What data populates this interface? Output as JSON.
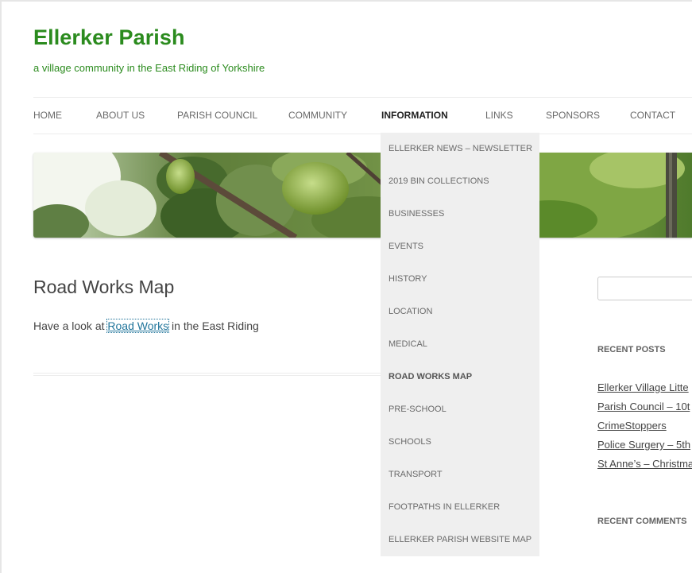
{
  "site": {
    "title": "Ellerker Parish",
    "description": "a village community in the East Riding of Yorkshire"
  },
  "nav": {
    "items": [
      {
        "label": "HOME"
      },
      {
        "label": "ABOUT US"
      },
      {
        "label": "PARISH COUNCIL"
      },
      {
        "label": "COMMUNITY"
      },
      {
        "label": "INFORMATION",
        "active": true
      },
      {
        "label": "LINKS"
      },
      {
        "label": "SPONSORS"
      },
      {
        "label": "CONTACT"
      }
    ]
  },
  "dropdown": {
    "items": [
      {
        "label": "ELLERKER NEWS – NEWSLETTER"
      },
      {
        "label": "2019 BIN COLLECTIONS"
      },
      {
        "label": "BUSINESSES"
      },
      {
        "label": "EVENTS"
      },
      {
        "label": "HISTORY"
      },
      {
        "label": "LOCATION"
      },
      {
        "label": "MEDICAL"
      },
      {
        "label": "ROAD WORKS MAP",
        "current": true
      },
      {
        "label": "PRE-SCHOOL"
      },
      {
        "label": "SCHOOLS"
      },
      {
        "label": "TRANSPORT"
      },
      {
        "label": "FOOTPATHS IN ELLERKER"
      },
      {
        "label": "ELLERKER PARISH WEBSITE MAP"
      }
    ]
  },
  "post": {
    "title": "Road Works Map",
    "text_before": "Have a look at ",
    "link_text": "Road Works",
    "text_after": " in the East Riding"
  },
  "sidebar": {
    "recent_posts_title": "RECENT POSTS",
    "recent_posts": [
      "Ellerker Village Litte",
      "Parish Council – 10t",
      "CrimeStoppers",
      "Police Surgery – 5th",
      "St Anne’s – Christma"
    ],
    "recent_comments_title": "RECENT COMMENTS"
  },
  "colors": {
    "brand_green": "#2b8b1e",
    "link_blue": "#21759b",
    "dropdown_bg": "#efefef"
  }
}
